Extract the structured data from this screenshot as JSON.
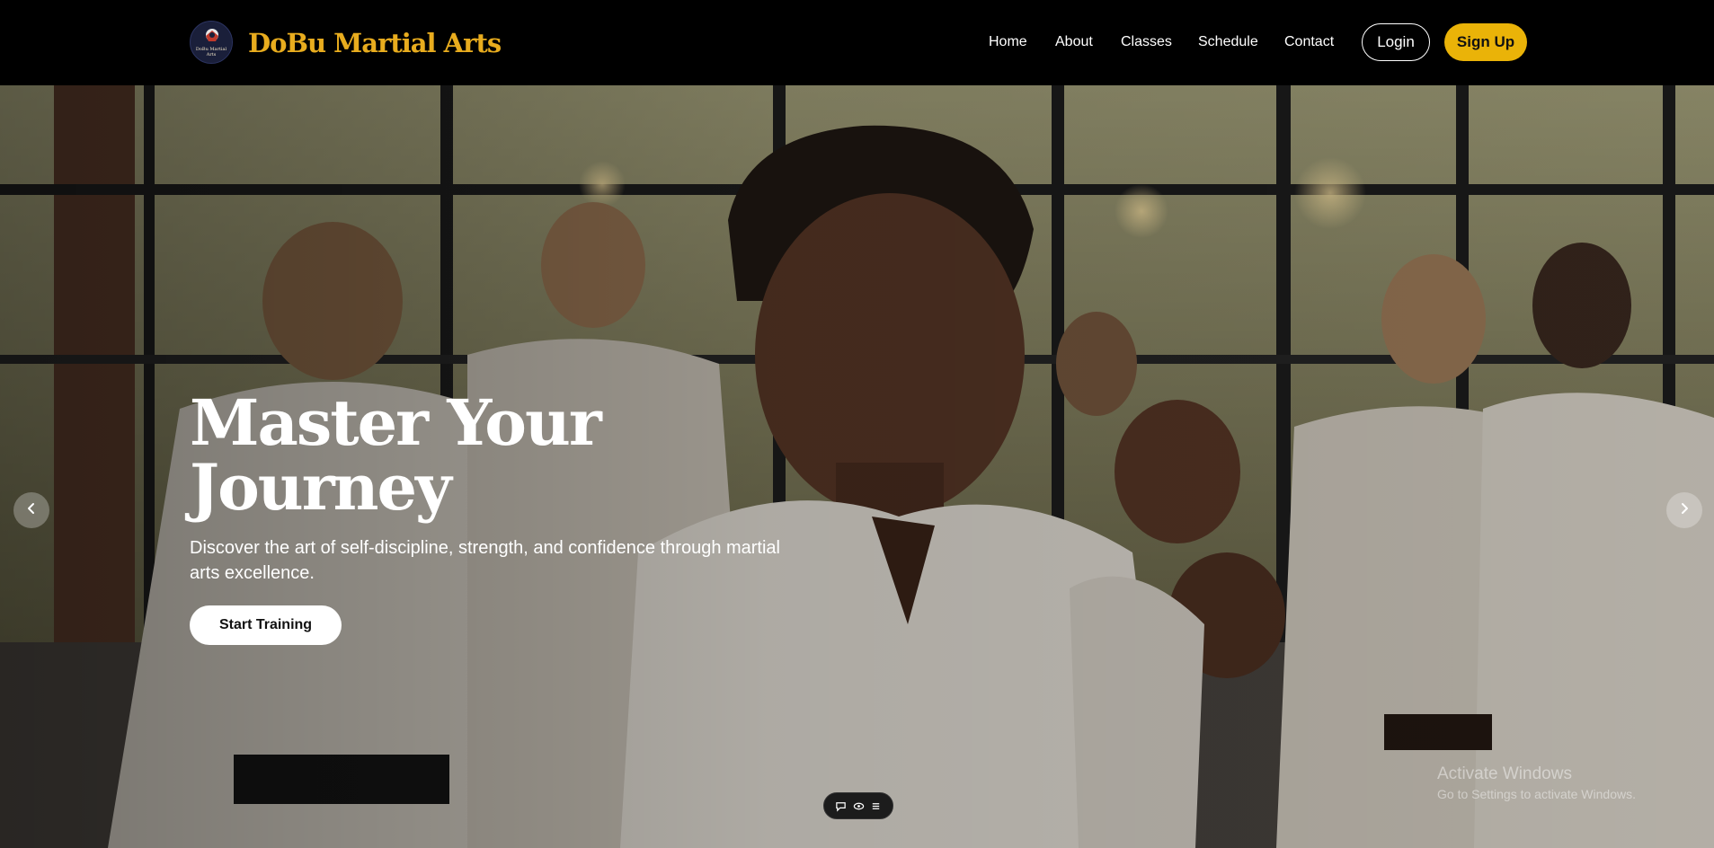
{
  "brand": {
    "name": "DoBu Martial Arts",
    "badge_text": "DoBu Martial Arts",
    "color": "#e8ac1e"
  },
  "nav": {
    "links": [
      "Home",
      "About",
      "Classes",
      "Schedule",
      "Contact"
    ],
    "login_label": "Login",
    "signup_label": "Sign Up",
    "signup_color": "#eab308"
  },
  "hero": {
    "title_line1": "Master Your",
    "title_line2": "Journey",
    "subtitle": "Discover the art of self-discipline, strength, and confidence through martial arts excellence.",
    "cta_label": "Start Training"
  },
  "carousel": {
    "prev_icon": "chevron-left-icon",
    "next_icon": "chevron-right-icon"
  },
  "toolbar": {
    "icons": [
      "comment-icon",
      "eye-icon",
      "menu-icon"
    ]
  },
  "watermark": {
    "title": "Activate Windows",
    "subtitle": "Go to Settings to activate Windows."
  }
}
